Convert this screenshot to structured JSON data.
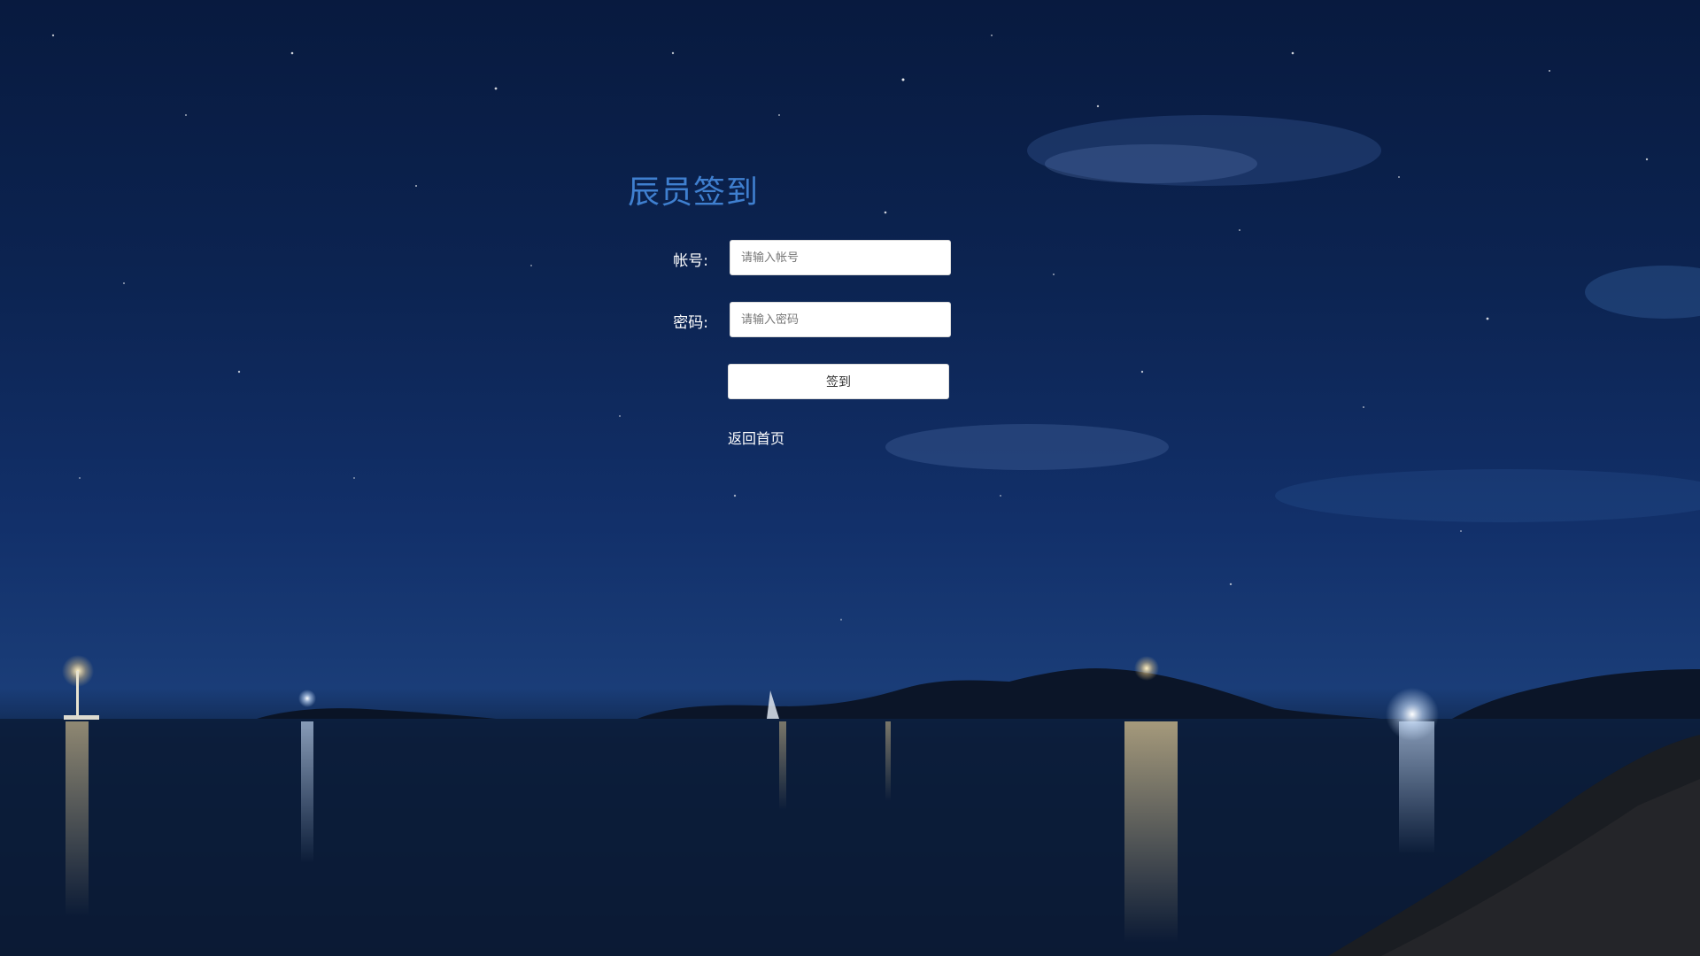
{
  "login": {
    "title": "辰员签到",
    "account_label": "帐号:",
    "account_placeholder": "请输入帐号",
    "password_label": "密码:",
    "password_placeholder": "请输入密码",
    "submit_label": "签到",
    "back_link": "返回首页"
  },
  "colors": {
    "title": "#3f7fcf",
    "sky_top": "#081a3f",
    "sky_horizon": "#1a3d78",
    "water": "#0a1a33"
  }
}
